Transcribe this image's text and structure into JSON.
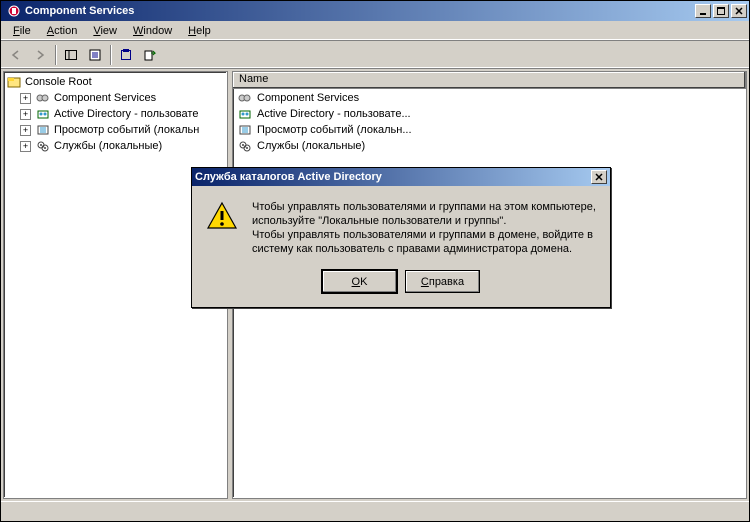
{
  "window": {
    "title": "Component Services"
  },
  "menubar": {
    "file": "File",
    "action": "Action",
    "view": "View",
    "window": "Window",
    "help": "Help"
  },
  "tree": {
    "root": "Console Root",
    "items": [
      "Component Services",
      "Active Directory - пользовате",
      "Просмотр событий (локальн",
      "Службы (локальные)"
    ]
  },
  "list": {
    "column": "Name",
    "rows": [
      "Component Services",
      "Active Directory - пользовате...",
      "Просмотр событий (локальн...",
      "Службы (локальные)"
    ]
  },
  "dialog": {
    "title": "Служба каталогов Active Directory",
    "message_line1": "Чтобы управлять пользователями и группами на этом компьютере, используйте \"Локальные пользователи и группы\".",
    "message_line2": "Чтобы управлять пользователями и группами в домене, войдите в систему как пользователь с правами администратора домена.",
    "ok_label": "OK",
    "help_label": "Справка"
  }
}
